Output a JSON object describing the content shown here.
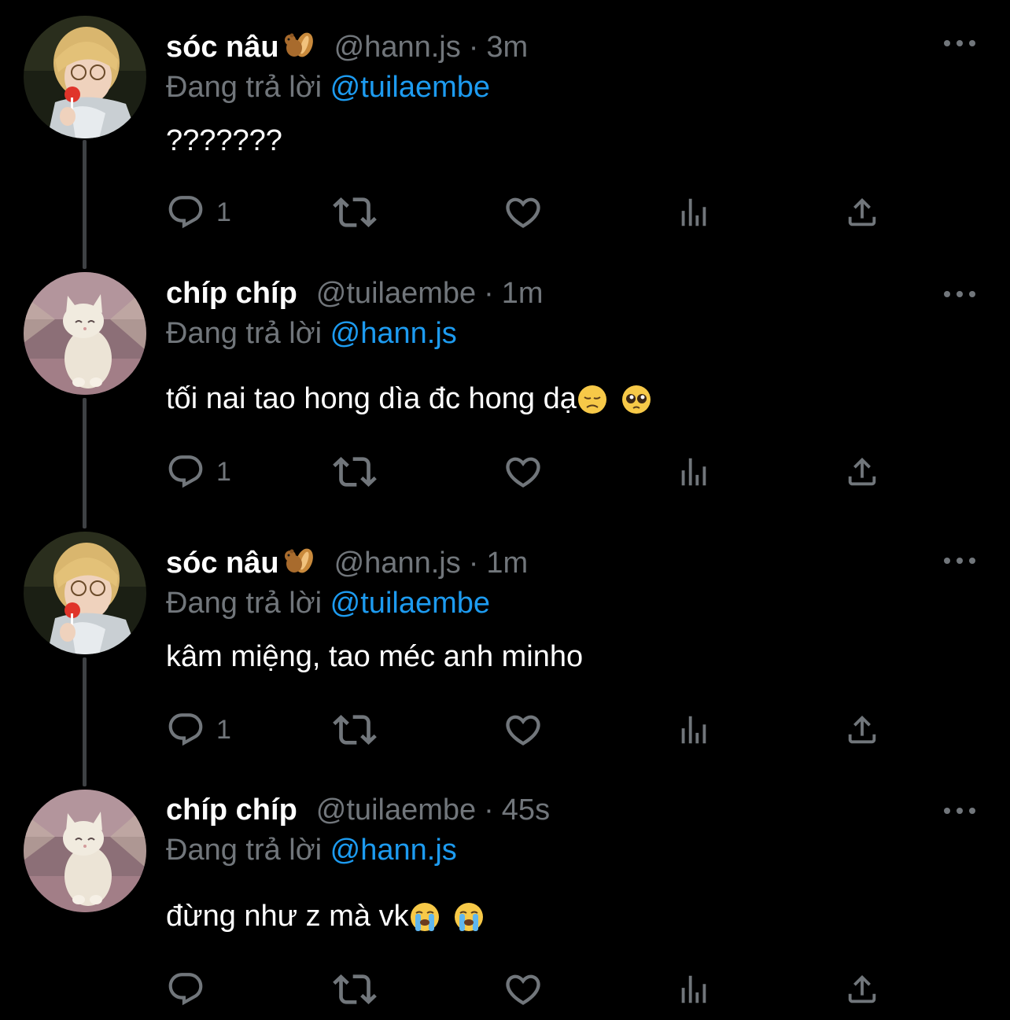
{
  "colors": {
    "background": "#000000",
    "name": "#ffffff",
    "muted": "#71767b",
    "mention": "#1d9bf0",
    "thread_line": "#3e4144"
  },
  "reply_prefix": "Đang trả lời",
  "tweets": [
    {
      "name": "sóc nâu",
      "name_emoji": "chipmunk-emoji",
      "handle": "@hann.js",
      "separator": "·",
      "time": "3m",
      "reply_to": "@tuilaembe",
      "text": "???????",
      "text_emojis": [],
      "avatar": "person-with-lollipop",
      "reply_count": "1"
    },
    {
      "name": "chíp chíp",
      "name_emoji": "",
      "handle": "@tuilaembe",
      "separator": "·",
      "time": "1m",
      "reply_to": "@hann.js",
      "text": "tối nai tao hong dìa đc hong dạ",
      "text_emojis": [
        "disappointed-face-emoji",
        "pleading-face-emoji"
      ],
      "avatar": "white-kitten",
      "reply_count": "1"
    },
    {
      "name": "sóc nâu",
      "name_emoji": "chipmunk-emoji",
      "handle": "@hann.js",
      "separator": "·",
      "time": "1m",
      "reply_to": "@tuilaembe",
      "text": "kâm miệng, tao méc anh minho",
      "text_emojis": [],
      "avatar": "person-with-lollipop",
      "reply_count": "1"
    },
    {
      "name": "chíp chíp",
      "name_emoji": "",
      "handle": "@tuilaembe",
      "separator": "·",
      "time": "45s",
      "reply_to": "@hann.js",
      "text": "đừng như z mà vk",
      "text_emojis": [
        "loudly-crying-face-emoji",
        "loudly-crying-face-emoji"
      ],
      "avatar": "white-kitten",
      "reply_count": ""
    }
  ]
}
